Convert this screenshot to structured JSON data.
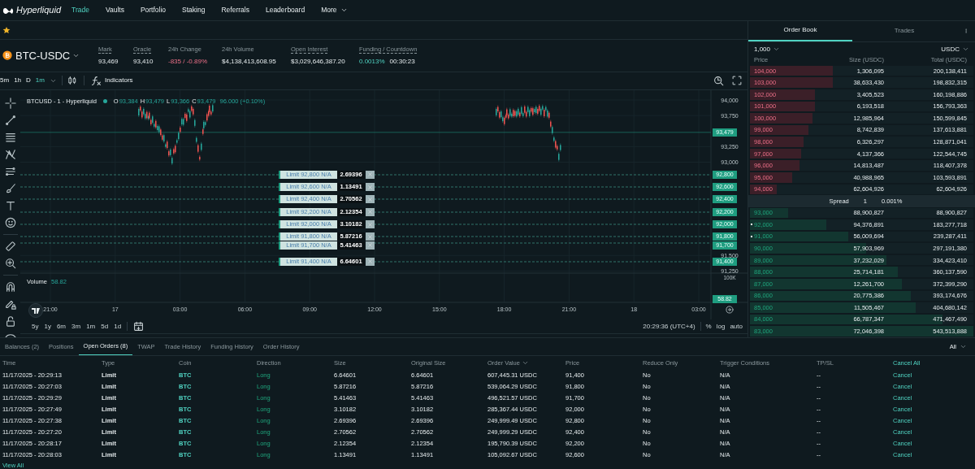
{
  "nav": {
    "brand": "Hyperliquid",
    "items": [
      {
        "label": "Trade",
        "selected": true,
        "kind": "link"
      },
      {
        "label": "Vaults",
        "selected": false,
        "kind": "link"
      },
      {
        "label": "Portfolio",
        "selected": false,
        "kind": "link"
      },
      {
        "label": "Staking",
        "selected": false,
        "kind": "link"
      },
      {
        "label": "Referrals",
        "selected": false,
        "kind": "link"
      },
      {
        "label": "Leaderboard",
        "selected": false,
        "kind": "link"
      },
      {
        "label": "More",
        "selected": false,
        "kind": "menu"
      }
    ]
  },
  "ticker": {
    "symbol": "BTC-USDC",
    "stats": [
      {
        "label": "Mark",
        "underlined": true,
        "values": [
          {
            "text": "93,469",
            "kind": "neutral"
          }
        ]
      },
      {
        "label": "Oracle",
        "underlined": true,
        "values": [
          {
            "text": "93,410",
            "kind": "neutral"
          }
        ]
      },
      {
        "label": "24h Change",
        "underlined": false,
        "values": [
          {
            "text": "-835 / -0.89%",
            "kind": "negative"
          }
        ]
      },
      {
        "label": "24h Volume",
        "underlined": false,
        "values": [
          {
            "text": "$4,138,413,608.95",
            "kind": "neutral"
          }
        ]
      },
      {
        "label": "Open Interest",
        "underlined": true,
        "values": [
          {
            "text": "$3,029,646,387.20",
            "kind": "neutral"
          }
        ]
      },
      {
        "label": "Funding / Countdown",
        "underlined": true,
        "values": [
          {
            "text": "0.0013%",
            "kind": "positive"
          },
          {
            "text": "00:30:23",
            "kind": "neutral"
          }
        ]
      }
    ]
  },
  "chart_toolbar": {
    "intervals": [
      {
        "label": "5m",
        "selected": false
      },
      {
        "label": "1h",
        "selected": false
      },
      {
        "label": "D",
        "selected": false
      },
      {
        "label": "1m",
        "selected": true
      }
    ],
    "indicators": "Indicators"
  },
  "chart": {
    "legend": {
      "title": "BTCUSD - 1 - Hyperliquid",
      "ohlc": [
        {
          "key": "O",
          "value": "93,384"
        },
        {
          "key": "H",
          "value": "93,479"
        },
        {
          "key": "L",
          "value": "93,366"
        },
        {
          "key": "C",
          "value": "93,479"
        }
      ],
      "change": "96.000 (+0.10%)"
    },
    "price_labels": [
      "94,000",
      "93,750",
      "93,250",
      "93,000",
      "91,500",
      "91,250"
    ],
    "last_price_tag": "93,479",
    "order_lines": [
      {
        "label": "Limit 92,800 N/A",
        "size": "2.69396",
        "axis_tag": "92,800"
      },
      {
        "label": "Limit 92,600 N/A",
        "size": "1.13491",
        "axis_tag": "92,600"
      },
      {
        "label": "Limit 92,400 N/A",
        "size": "2.70562",
        "axis_tag": "92,400"
      },
      {
        "label": "Limit 92,200 N/A",
        "size": "2.12354",
        "axis_tag": "92,200"
      },
      {
        "label": "Limit 92,000 N/A",
        "size": "3.10182",
        "axis_tag": "92,000"
      },
      {
        "label": "Limit 91,800 N/A",
        "size": "5.87216",
        "axis_tag": "91,800"
      },
      {
        "label": "Limit 91,700 N/A",
        "size": "5.41463",
        "axis_tag": "91,700"
      },
      {
        "label": "Limit 91,400 N/A",
        "size": "6.64601",
        "axis_tag": "91,400"
      }
    ],
    "volume": {
      "label": "Volume",
      "value": "58.82",
      "axis_label": "100K",
      "tag": "58.82"
    },
    "time_labels": [
      "21:00",
      "17",
      "03:00",
      "06:00",
      "09:00",
      "12:00",
      "15:00",
      "18:00",
      "21:00",
      "18",
      "03:00"
    ]
  },
  "range_bar": {
    "ranges": [
      "5y",
      "1y",
      "6m",
      "3m",
      "1m",
      "5d",
      "1d"
    ],
    "clock": "20:29:36 (UTC+4)",
    "options": [
      "%",
      "log",
      "auto"
    ]
  },
  "order_book": {
    "tabs": [
      {
        "label": "Order Book",
        "selected": true
      },
      {
        "label": "Trades",
        "selected": false
      }
    ],
    "tick": "1,000",
    "unit": "USDC",
    "columns": [
      "Price",
      "Size (USDC)",
      "Total (USDC)"
    ],
    "asks": [
      {
        "price": "104,000",
        "size": "1,306,095",
        "total": "200,138,411",
        "level": 0.37
      },
      {
        "price": "103,000",
        "size": "38,633,430",
        "total": "198,832,315",
        "level": 0.37
      },
      {
        "price": "102,000",
        "size": "3,405,523",
        "total": "160,198,886",
        "level": 0.29
      },
      {
        "price": "101,000",
        "size": "6,193,518",
        "total": "156,793,363",
        "level": 0.29
      },
      {
        "price": "100,000",
        "size": "12,985,964",
        "total": "150,599,845",
        "level": 0.28
      },
      {
        "price": "99,000",
        "size": "8,742,839",
        "total": "137,613,881",
        "level": 0.26
      },
      {
        "price": "98,000",
        "size": "6,326,297",
        "total": "128,871,041",
        "level": 0.24
      },
      {
        "price": "97,000",
        "size": "4,137,366",
        "total": "122,544,745",
        "level": 0.23
      },
      {
        "price": "96,000",
        "size": "14,813,487",
        "total": "118,407,378",
        "level": 0.22
      },
      {
        "price": "95,000",
        "size": "40,988,965",
        "total": "103,593,891",
        "level": 0.19
      },
      {
        "price": "94,000",
        "size": "62,604,926",
        "total": "62,604,926",
        "level": 0.12
      }
    ],
    "spread": {
      "label": "Spread",
      "value": "1",
      "percent": "0.001%"
    },
    "bids": [
      {
        "price": "93,000",
        "size": "88,900,827",
        "total": "88,900,827",
        "level": 0.17,
        "own_order": false
      },
      {
        "price": "92,000",
        "size": "94,376,891",
        "total": "183,277,718",
        "level": 0.34,
        "own_order": true
      },
      {
        "price": "91,000",
        "size": "56,009,694",
        "total": "239,287,411",
        "level": 0.44,
        "own_order": true
      },
      {
        "price": "90,000",
        "size": "57,903,969",
        "total": "297,191,380",
        "level": 0.52,
        "own_order": false
      },
      {
        "price": "89,000",
        "size": "37,232,029",
        "total": "334,423,410",
        "level": 0.61,
        "own_order": false
      },
      {
        "price": "88,000",
        "size": "25,714,181",
        "total": "360,137,590",
        "level": 0.66,
        "own_order": false
      },
      {
        "price": "87,000",
        "size": "12,261,700",
        "total": "372,399,290",
        "level": 0.68,
        "own_order": false
      },
      {
        "price": "86,000",
        "size": "20,775,386",
        "total": "393,174,676",
        "level": 0.72,
        "own_order": false
      },
      {
        "price": "85,000",
        "size": "11,505,467",
        "total": "404,680,142",
        "level": 0.74,
        "own_order": false
      },
      {
        "price": "84,000",
        "size": "66,787,347",
        "total": "471,467,490",
        "level": 0.86,
        "own_order": false
      },
      {
        "price": "83,000",
        "size": "72,046,398",
        "total": "543,513,888",
        "level": 1
      }
    ]
  },
  "orders_panel": {
    "tabs": [
      {
        "label": "Balances (2)",
        "selected": false
      },
      {
        "label": "Positions",
        "selected": false
      },
      {
        "label": "Open Orders (8)",
        "selected": true
      },
      {
        "label": "TWAP",
        "selected": false
      },
      {
        "label": "Trade History",
        "selected": false
      },
      {
        "label": "Funding History",
        "selected": false
      },
      {
        "label": "Order History",
        "selected": false
      }
    ],
    "filter": "All",
    "columns": [
      {
        "label": "Time",
        "sorted": false,
        "kind": "text"
      },
      {
        "label": "Type",
        "sorted": false,
        "kind": "text"
      },
      {
        "label": "Coin",
        "sorted": false,
        "kind": "text"
      },
      {
        "label": "Direction",
        "sorted": false,
        "kind": "text"
      },
      {
        "label": "Size",
        "sorted": false,
        "kind": "text"
      },
      {
        "label": "Original Size",
        "sorted": false,
        "kind": "text"
      },
      {
        "label": "Order Value",
        "sorted": true,
        "kind": "text"
      },
      {
        "label": "Price",
        "sorted": false,
        "kind": "text"
      },
      {
        "label": "Reduce Only",
        "sorted": false,
        "kind": "text"
      },
      {
        "label": "Trigger Conditions",
        "sorted": false,
        "kind": "text"
      },
      {
        "label": "TP/SL",
        "sorted": false,
        "kind": "text"
      },
      {
        "label": "Cancel All",
        "sorted": false,
        "kind": "action"
      }
    ],
    "rows": [
      [
        "11/17/2025 - 20:29:13",
        "Limit",
        "BTC",
        "Long",
        "6.64601",
        "6.64601",
        "607,445.31 USDC",
        "91,400",
        "No",
        "N/A",
        "--",
        "Cancel"
      ],
      [
        "11/17/2025 - 20:27:03",
        "Limit",
        "BTC",
        "Long",
        "5.87216",
        "5.87216",
        "539,064.29 USDC",
        "91,800",
        "No",
        "N/A",
        "--",
        "Cancel"
      ],
      [
        "11/17/2025 - 20:29:29",
        "Limit",
        "BTC",
        "Long",
        "5.41463",
        "5.41463",
        "496,521.57 USDC",
        "91,700",
        "No",
        "N/A",
        "--",
        "Cancel"
      ],
      [
        "11/17/2025 - 20:27:49",
        "Limit",
        "BTC",
        "Long",
        "3.10182",
        "3.10182",
        "285,367.44 USDC",
        "92,000",
        "No",
        "N/A",
        "--",
        "Cancel"
      ],
      [
        "11/17/2025 - 20:27:38",
        "Limit",
        "BTC",
        "Long",
        "2.69396",
        "2.69396",
        "249,999.49 USDC",
        "92,800",
        "No",
        "N/A",
        "--",
        "Cancel"
      ],
      [
        "11/17/2025 - 20:27:20",
        "Limit",
        "BTC",
        "Long",
        "2.70562",
        "2.70562",
        "249,999.29 USDC",
        "92,400",
        "No",
        "N/A",
        "--",
        "Cancel"
      ],
      [
        "11/17/2025 - 20:28:17",
        "Limit",
        "BTC",
        "Long",
        "2.12354",
        "2.12354",
        "195,790.39 USDC",
        "92,200",
        "No",
        "N/A",
        "--",
        "Cancel"
      ],
      [
        "11/17/2025 - 20:28:03",
        "Limit",
        "BTC",
        "Long",
        "1.13491",
        "1.13491",
        "105,092.67 USDC",
        "92,600",
        "No",
        "N/A",
        "--",
        "Cancel"
      ]
    ],
    "view_all": "View All"
  }
}
